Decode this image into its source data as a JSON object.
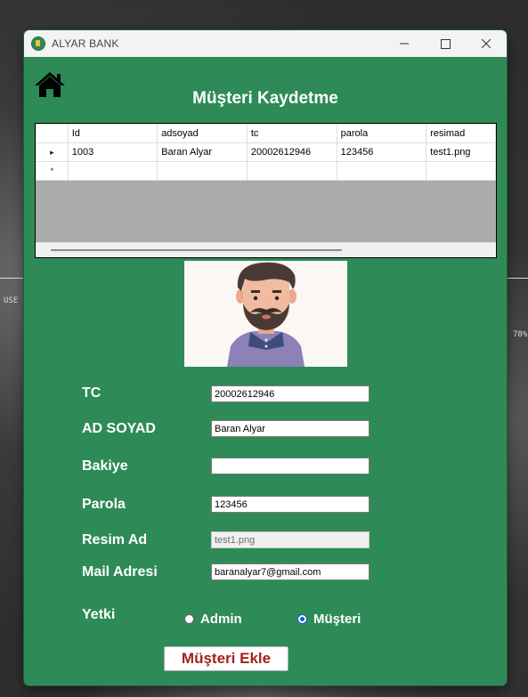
{
  "window": {
    "title": "ALYAR BANK"
  },
  "page": {
    "title": "Müşteri Kaydetme"
  },
  "grid": {
    "columns": [
      "Id",
      "adsoyad",
      "tc",
      "parola",
      "resimad"
    ],
    "rows": [
      {
        "marker": "▸",
        "cells": [
          "1003",
          "Baran Alyar",
          "20002612946",
          "123456",
          "test1.png"
        ]
      }
    ],
    "new_row_marker": "*"
  },
  "form": {
    "tc": {
      "label": "TC",
      "value": "20002612946"
    },
    "adsoyad": {
      "label": "AD SOYAD",
      "value": "Baran Alyar"
    },
    "bakiye": {
      "label": "Bakiye",
      "value": ""
    },
    "parola": {
      "label": "Parola",
      "value": "123456"
    },
    "resimad": {
      "label": "Resim Ad",
      "value": "test1.png"
    },
    "mail": {
      "label": "Mail Adresi",
      "value": "baranalyar7@gmail.com"
    },
    "yetki": {
      "label": "Yetki",
      "options": [
        "Admin",
        "Müşteri"
      ],
      "selected": "Müşteri"
    }
  },
  "actions": {
    "add_label": "Müşteri Ekle"
  },
  "desktop": {
    "left_text": "USE",
    "right_text": "78%"
  },
  "colors": {
    "form_bg": "#2e8b57",
    "button_text": "#a4211c",
    "radio_accent": "#0a5ed1"
  }
}
